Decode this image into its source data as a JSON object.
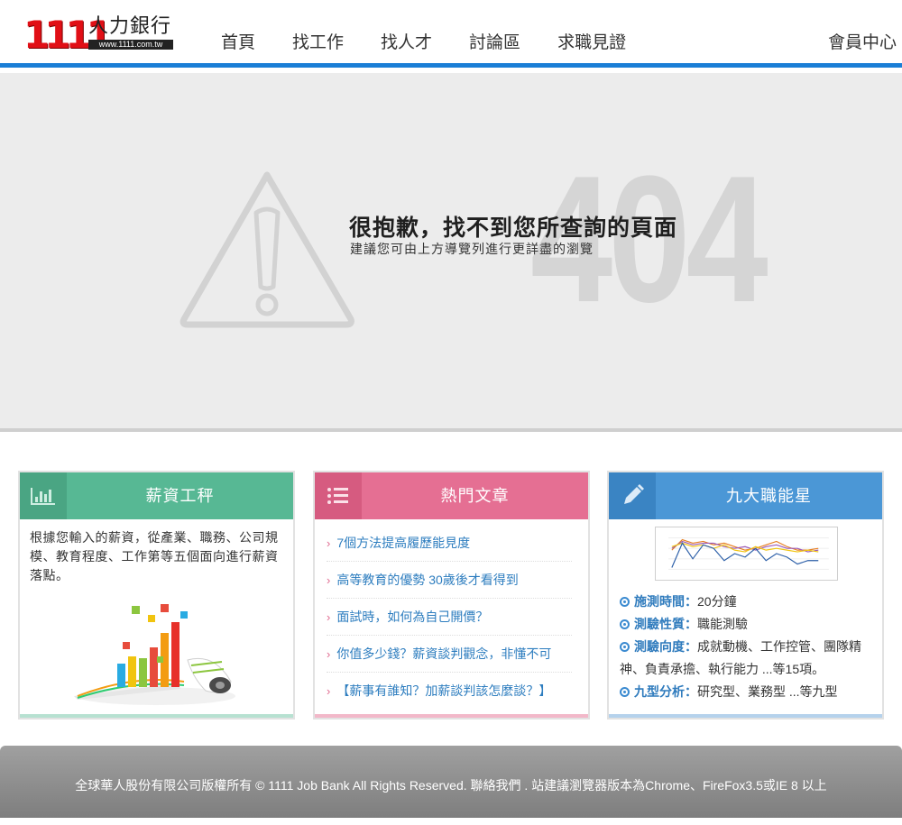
{
  "header": {
    "logo_number": "1111",
    "logo_brand": "人力銀行",
    "logo_url": "www.1111.com.tw",
    "nav": [
      "首頁",
      "找工作",
      "找人才",
      "討論區",
      "求職見證"
    ],
    "member": "會員中心",
    "accent_color": "#1a7ed6"
  },
  "error": {
    "code": "404",
    "title": "很抱歉，找不到您所查詢的頁面",
    "subtitle": "建議您可由上方導覽列進行更詳盡的瀏覽"
  },
  "cards": {
    "salary": {
      "title": "薪資工秤",
      "icon": "bar-chart-icon",
      "desc": "根據您輸入的薪資，從產業、職務、公司規模、教育程度、工作第等五個面向進行薪資落點。",
      "color": "#57b894"
    },
    "articles": {
      "title": "熱門文章",
      "icon": "list-icon",
      "color": "#e56f93",
      "items": [
        "7個方法提高履歷能見度",
        "高等教育的優勢 30歲後才看得到",
        "面試時，如何為自己開價？",
        "你值多少錢？薪資談判觀念，非懂不可",
        "【薪事有誰知？加薪談判該怎麼談？】"
      ]
    },
    "stars": {
      "title": "九大職能星",
      "icon": "pencil-icon",
      "color": "#4b97d6",
      "info": [
        {
          "key": "施測時間",
          "value": "20分鐘"
        },
        {
          "key": "測驗性質",
          "value": "職能測驗"
        },
        {
          "key": "測驗向度",
          "value": "成就動機、工作控管、團隊精神、負責承擔、執行能力 ...等15項。"
        },
        {
          "key": "九型分析",
          "value": "研究型、業務型 ...等九型"
        }
      ]
    }
  },
  "footer": {
    "text": "全球華人股份有限公司版權所有 © 1111 Job Bank All Rights Reserved. 聯絡我們 . 站建議瀏覽器版本為Chrome、FireFox3.5或IE 8 以上"
  }
}
